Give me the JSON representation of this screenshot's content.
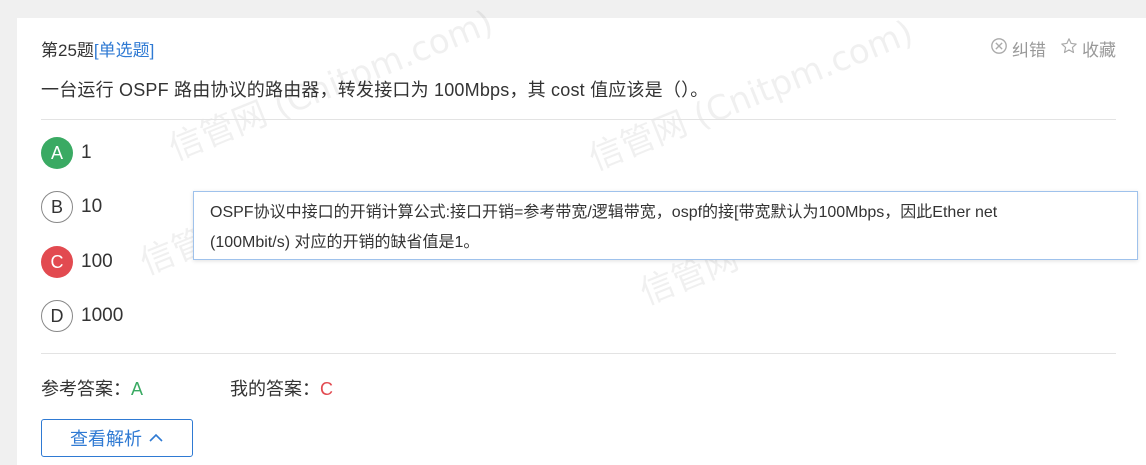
{
  "question": {
    "number_label": "第25题",
    "type_label": "[单选题]",
    "text": "一台运行 OSPF 路由协议的路由器，转发接口为 100Mbps，其 cost 值应该是（）。"
  },
  "tools": {
    "report_label": "纠错",
    "favorite_label": "收藏"
  },
  "options": [
    {
      "letter": "A",
      "value": "1",
      "state": "correct"
    },
    {
      "letter": "B",
      "value": "10",
      "state": "plain"
    },
    {
      "letter": "C",
      "value": "100",
      "state": "wrong"
    },
    {
      "letter": "D",
      "value": "1000",
      "state": "plain"
    }
  ],
  "tooltip": {
    "line1": "OSPF协议中接口的开销计算公式:接口开销=参考带宽/逻辑带宽，ospf的接[带宽默认为100Mbps，因此Ether net",
    "line2": "(100Mbit/s) 对应的开销的缺省值是1。"
  },
  "answers": {
    "reference_label": "参考答案：",
    "reference_value": "A",
    "mine_label": "我的答案：",
    "mine_value": "C"
  },
  "analysis_button": {
    "label": "查看解析"
  },
  "watermark": {
    "text_a": "信管网 (Cnitpm.com)",
    "text_b": "信管网"
  },
  "colors": {
    "correct": "#3aaa63",
    "wrong": "#e24a50",
    "link": "#2f7ad3"
  }
}
